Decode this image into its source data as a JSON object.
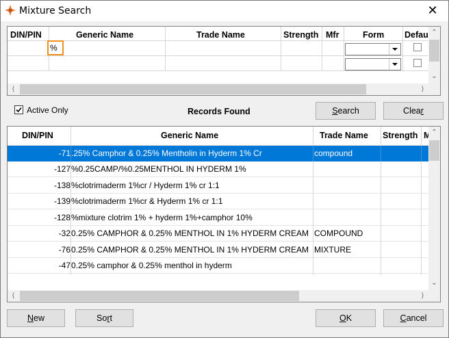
{
  "window": {
    "title": "Mixture Search",
    "close_glyph": "✕"
  },
  "search_grid": {
    "columns": [
      "DIN/PIN",
      "Generic Name",
      "Trade Name",
      "Strength",
      "Mfr",
      "Form",
      "Defau"
    ],
    "generic_name_value": "%"
  },
  "controls": {
    "active_only_label": "Active Only",
    "active_only_checked": true,
    "records_found_label": "Records Found",
    "search_button": {
      "hotkey": "S",
      "rest": "earch"
    },
    "clear_button": {
      "pre": "Clea",
      "hotkey": "r"
    }
  },
  "results_grid": {
    "columns": [
      "DIN/PIN",
      "Generic Name",
      "Trade Name",
      "Strength",
      "M"
    ],
    "rows": [
      {
        "din": "-71",
        "generic": ".25% Camphor & 0.25% Mentholin in Hyderm 1% Cr",
        "trade": "compound",
        "selected": true
      },
      {
        "din": "-127",
        "generic": "%0.25CAMP/%0.25MENTHOL IN HYDERM 1%",
        "trade": "",
        "selected": false
      },
      {
        "din": "-138",
        "generic": "%clotrimaderm 1%cr / Hyderm 1% cr 1:1",
        "trade": "",
        "selected": false
      },
      {
        "din": "-139",
        "generic": "%clotrimaderm 1%cr & Hyderm 1% cr 1:1",
        "trade": "",
        "selected": false
      },
      {
        "din": "-128",
        "generic": "%mixture clotrim 1% + hyderm 1%+camphor 10%",
        "trade": "",
        "selected": false
      },
      {
        "din": "-32",
        "generic": "0.25% CAMPHOR & 0.25% MENTHOL IN 1% HYDERM CREAM",
        "trade": "COMPOUND",
        "selected": false
      },
      {
        "din": "-76",
        "generic": "0.25% CAMPHOR & 0.25% MENTHOL IN 1% HYDERM CREAM",
        "trade": "MIXTURE",
        "selected": false
      },
      {
        "din": "-47",
        "generic": "0.25% camphor & 0.25% menthol in hyderm",
        "trade": "",
        "selected": false
      }
    ]
  },
  "footer": {
    "new_button": {
      "hotkey": "N",
      "rest": "ew"
    },
    "sort_button": {
      "pre": "So",
      "hotkey": "r",
      "rest": "t"
    },
    "ok_button": {
      "hotkey": "O",
      "rest": "K"
    },
    "cancel_button": {
      "hotkey": "C",
      "rest": "ancel"
    }
  },
  "colors": {
    "selection": "#0078d7",
    "focus_outline": "#f0901f"
  }
}
